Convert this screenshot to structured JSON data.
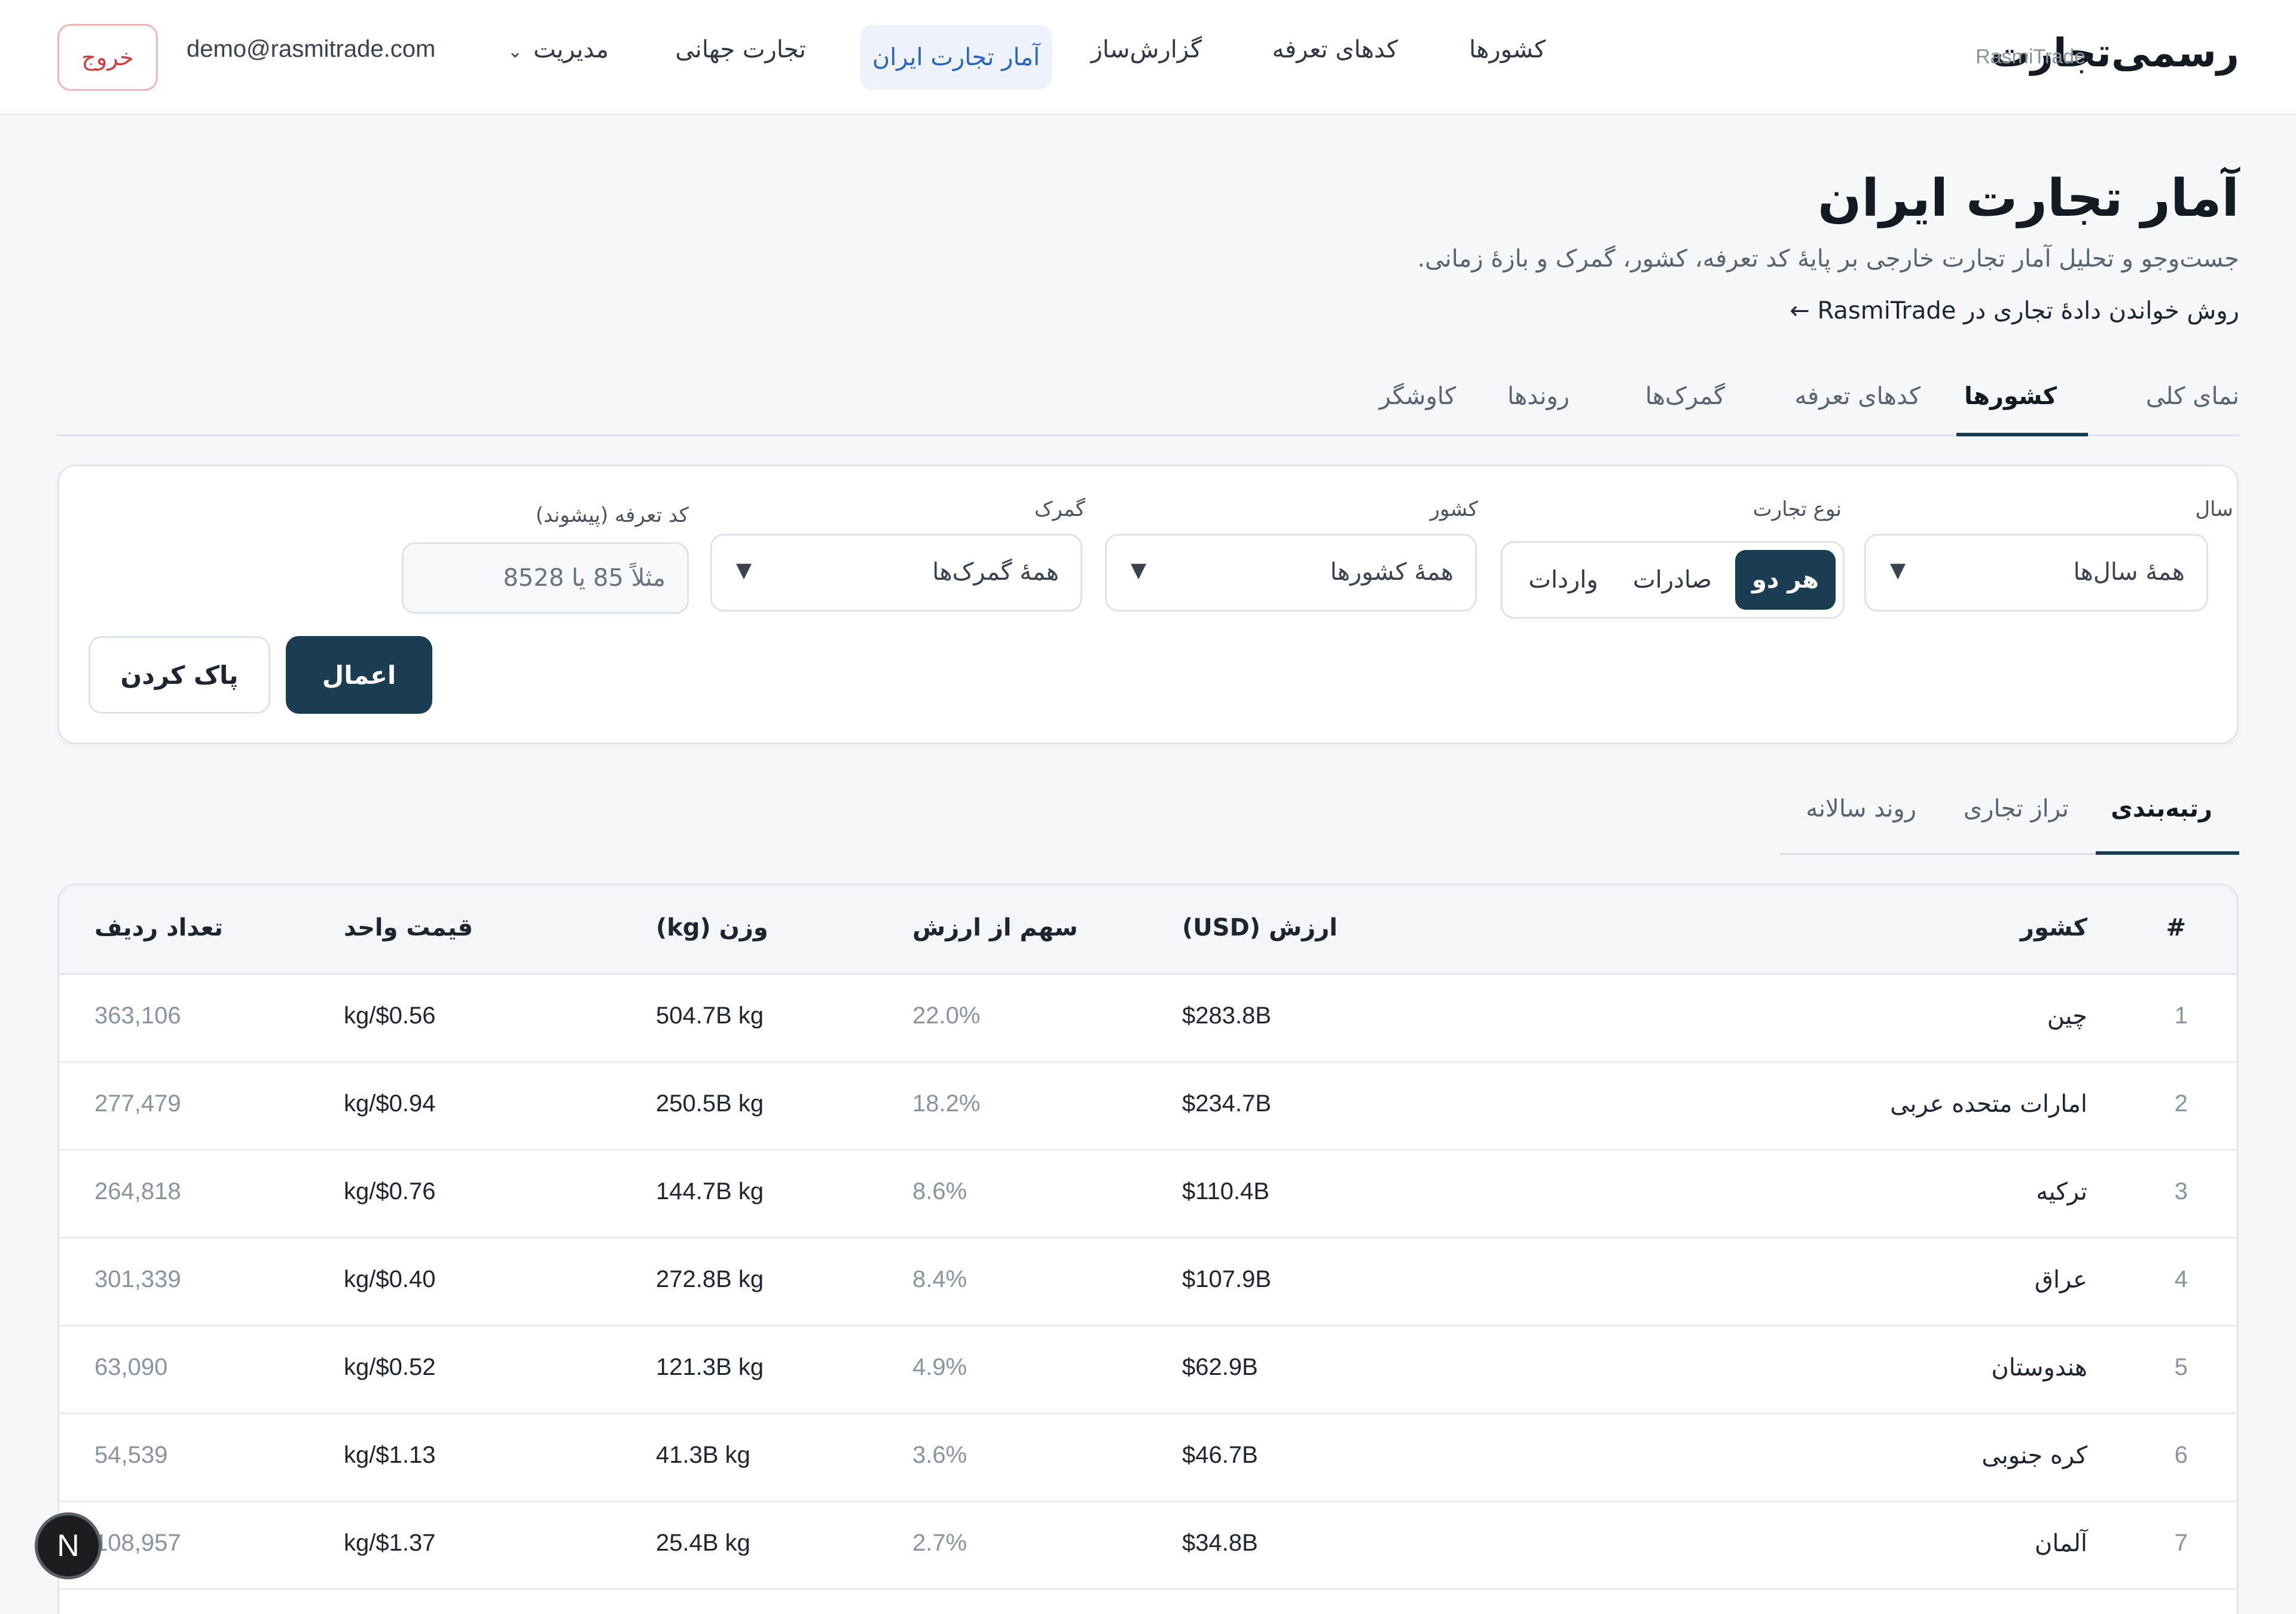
{
  "header": {
    "brand": "رسمی‌تجارت",
    "brand_en": "RasmiTrade",
    "nav": {
      "countries": "کشورها",
      "tariff_codes": "کدهای تعرفه",
      "report_builder": "گزارش‌ساز",
      "iran_trade_stats": "آمار تجارت ایران",
      "world_trade": "تجارت جهانی",
      "admin": "مدیریت"
    },
    "email": "demo@rasmitrade.com",
    "logout": "خروج"
  },
  "page": {
    "title": "آمار تجارت ایران",
    "subtitle": "جست‌وجو و تحلیل آمار تجارت خارجی بر پایهٔ کد تعرفه، کشور، گمرک و بازهٔ زمانی.",
    "guide_link": "روش خواندن دادهٔ تجاری در RasmiTrade ←"
  },
  "tabs": {
    "overview": "نمای کلی",
    "countries": "کشورها",
    "tariff_codes": "کدهای تعرفه",
    "customs": "گمرک‌ها",
    "trends": "روندها",
    "explorer": "کاوشگر"
  },
  "filters": {
    "year_label": "سال",
    "year_value": "همهٔ سال‌ها",
    "trade_type_label": "نوع تجارت",
    "trade_type_options": [
      "هر دو",
      "صادرات",
      "واردات"
    ],
    "country_label": "کشور",
    "country_value": "همهٔ کشورها",
    "customs_label": "گمرک",
    "customs_value": "همهٔ گمرک‌ها",
    "tariff_label": "کد تعرفه (پیشوند)",
    "tariff_placeholder": "مثلاً 85 یا 8528",
    "apply": "اعمال",
    "clear": "پاک کردن"
  },
  "subtabs": {
    "ranking": "رتبه‌بندی",
    "balance": "تراز تجاری",
    "annual_trend": "روند سالانه"
  },
  "table": {
    "columns": {
      "index": "#",
      "country": "کشور",
      "value": "ارزش (USD)",
      "share": "سهم از ارزش",
      "weight": "وزن (kg)",
      "unit_price": "قیمت واحد",
      "row_count": "تعداد ردیف"
    },
    "rows": [
      {
        "index": "1",
        "country": "چین",
        "value": "$283.8B",
        "share": "22.0%",
        "weight": "504.7B kg",
        "unit_price": "kg/$0.56",
        "row_count": "363,106"
      },
      {
        "index": "2",
        "country": "امارات متحده عربی",
        "value": "$234.7B",
        "share": "18.2%",
        "weight": "250.5B kg",
        "unit_price": "kg/$0.94",
        "row_count": "277,479"
      },
      {
        "index": "3",
        "country": "ترکیه",
        "value": "$110.4B",
        "share": "8.6%",
        "weight": "144.7B kg",
        "unit_price": "kg/$0.76",
        "row_count": "264,818"
      },
      {
        "index": "4",
        "country": "عراق",
        "value": "$107.9B",
        "share": "8.4%",
        "weight": "272.8B kg",
        "unit_price": "kg/$0.40",
        "row_count": "301,339"
      },
      {
        "index": "5",
        "country": "هندوستان",
        "value": "$62.9B",
        "share": "4.9%",
        "weight": "121.3B kg",
        "unit_price": "kg/$0.52",
        "row_count": "63,090"
      },
      {
        "index": "6",
        "country": "کره جنوبی",
        "value": "$46.7B",
        "share": "3.6%",
        "weight": "41.3B kg",
        "unit_price": "kg/$1.13",
        "row_count": "54,539"
      },
      {
        "index": "7",
        "country": "آلمان",
        "value": "$34.8B",
        "share": "2.7%",
        "weight": "25.4B kg",
        "unit_price": "kg/$1.37",
        "row_count": "108,957"
      }
    ]
  },
  "badge": "N",
  "colors": {
    "accent": "#1b3d52",
    "nav_active_text": "#2a63c9",
    "logout": "#d23a3a"
  }
}
